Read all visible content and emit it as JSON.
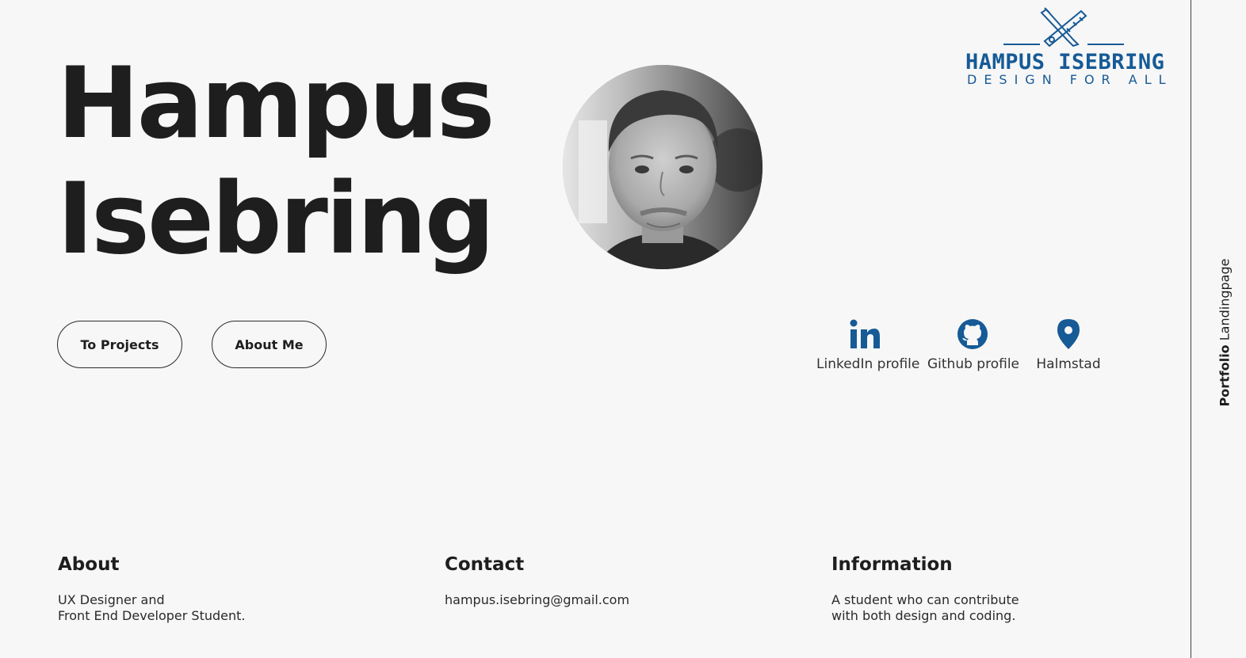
{
  "hero": {
    "first_name": "Hampus",
    "last_name": "Isebring"
  },
  "logo": {
    "name": "HAMPUS ISEBRING",
    "tagline": "DESIGN FOR ALL",
    "color": "#165a96",
    "icon": "pencil-ruler-icon"
  },
  "buttons": {
    "projects_label": "To Projects",
    "about_label": "About Me"
  },
  "social": {
    "linkedin_label": "LinkedIn profile",
    "github_label": "Github profile",
    "location_label": "Halmstad",
    "icon_color": "#165a96"
  },
  "sidebar": {
    "label_bold": "Portfolio",
    "label_regular": "Landingpage"
  },
  "footer": {
    "about": {
      "heading": "About",
      "lines": [
        "UX Designer and",
        "Front End Developer Student."
      ]
    },
    "contact": {
      "heading": "Contact",
      "email": "hampus.isebring@gmail.com"
    },
    "information": {
      "heading": "Information",
      "lines": [
        "A student who can contribute",
        "with both design and coding."
      ]
    }
  }
}
